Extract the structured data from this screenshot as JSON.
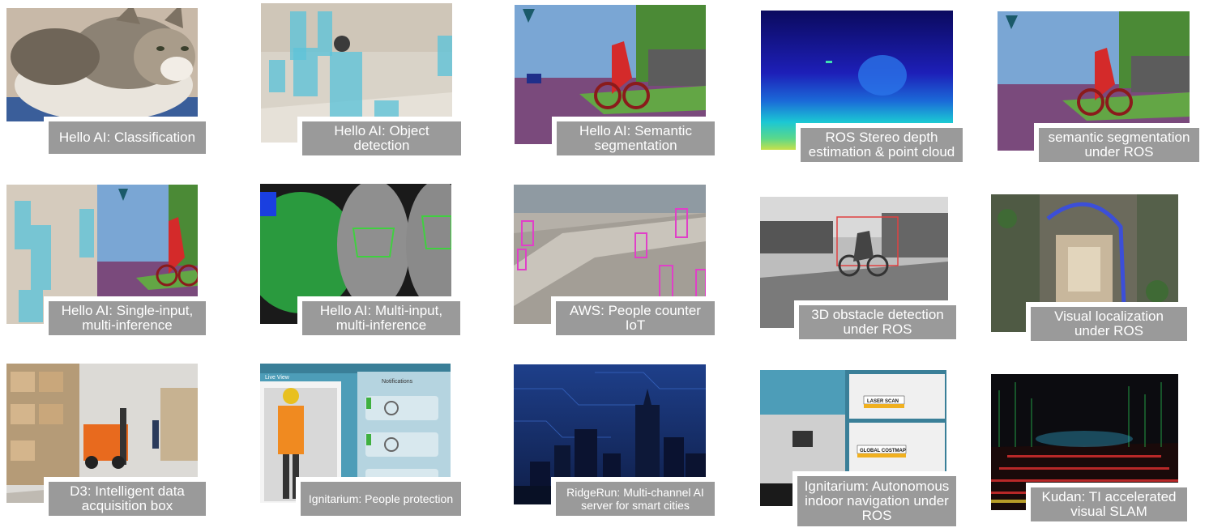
{
  "tiles": [
    {
      "id": "classification",
      "caption": "Hello AI: Classification",
      "image": "cat photo"
    },
    {
      "id": "object-detection",
      "caption": "Hello AI: Object\ndetection",
      "image": "mall people detection"
    },
    {
      "id": "semantic-segmentation",
      "caption": "Hello AI: Semantic\nsegmentation",
      "image": "street segmentation"
    },
    {
      "id": "ros-stereo",
      "caption": "ROS Stereo depth\nestimation & point cloud",
      "image": "depth map"
    },
    {
      "id": "ros-semantic",
      "caption": "semantic segmentation\nunder ROS",
      "image": "street segmentation"
    },
    {
      "id": "single-input",
      "caption": "Hello AI: Single-input,\nmulti-inference",
      "image": "detection and segmentation"
    },
    {
      "id": "multi-input",
      "caption": "Hello AI: Multi-input,\nmulti-inference",
      "image": "fisheye cameras"
    },
    {
      "id": "aws-people",
      "caption": "AWS: People counter\nIoT",
      "image": "street people detection"
    },
    {
      "id": "ros-3d-obstacle",
      "caption": "3D obstacle detection\nunder ROS",
      "image": "grayscale cyclist"
    },
    {
      "id": "visual-localization",
      "caption": "Visual localization\nunder ROS",
      "image": "aerial view"
    },
    {
      "id": "d3",
      "caption": "D3: Intelligent data\nacquisition box",
      "image": "warehouse forklift"
    },
    {
      "id": "ignitarium-protection",
      "caption": "Ignitarium: People  protection",
      "image": "worker PPE"
    },
    {
      "id": "ridgerun",
      "caption": "RidgeRun:  Multi-channel AI\nserver for smart cities",
      "image": "city skyline"
    },
    {
      "id": "ignitarium-navigation",
      "caption": "Ignitarium: Autonomous\nindoor navigation under\nROS",
      "image": "robot navigation"
    },
    {
      "id": "kudan",
      "caption": "Kudan: TI accelerated\nvisual SLAM",
      "image": "point cloud SLAM"
    }
  ],
  "overlay_labels": {
    "laser_scan": "LASER SCAN",
    "global_costmap": "GLOBAL COSTMAP",
    "live_view": "Live View",
    "notifications": "Notifications"
  }
}
